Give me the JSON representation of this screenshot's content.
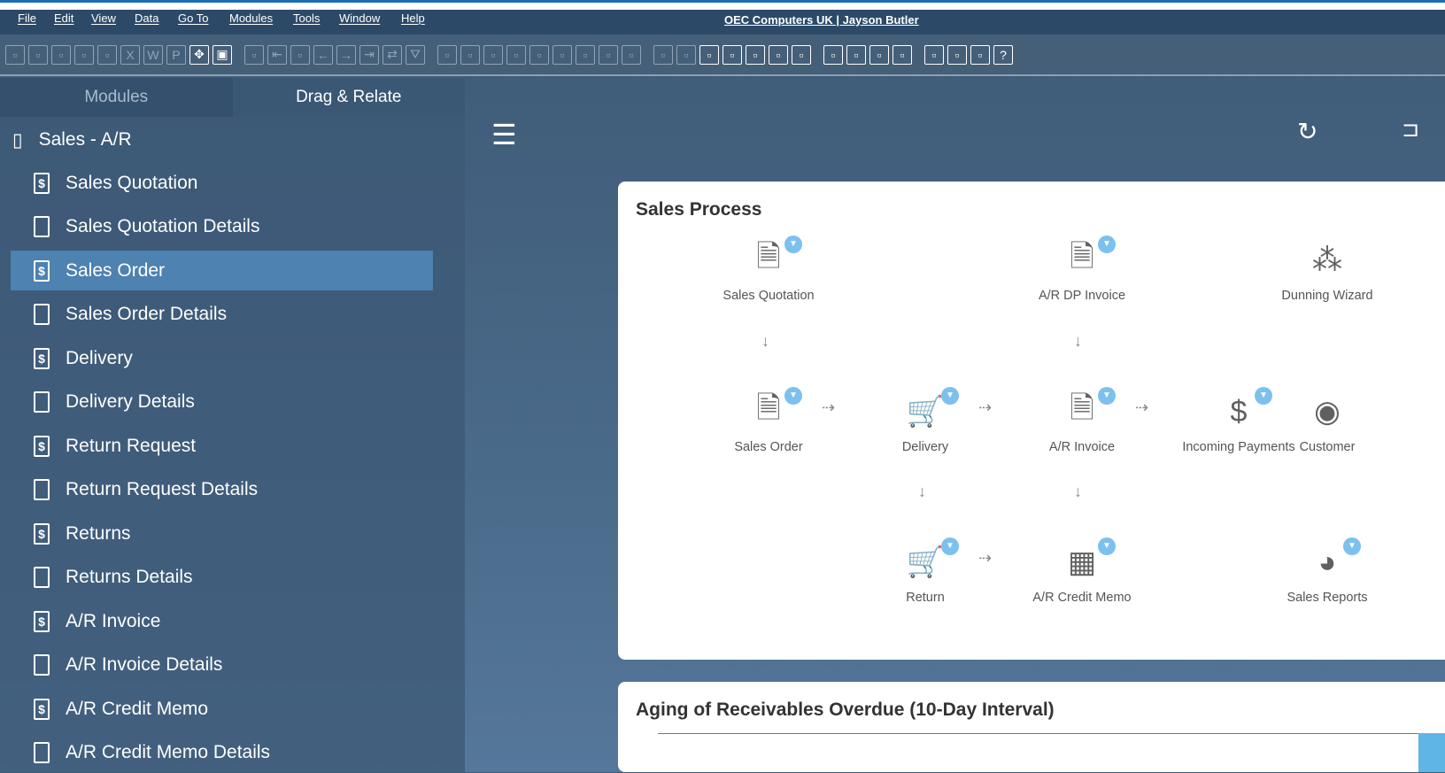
{
  "menu": [
    "File",
    "Edit",
    "View",
    "Data",
    "Go To",
    "Modules",
    "Tools",
    "Window",
    "Help"
  ],
  "company": "OEC Computers UK | Jayson Butler",
  "toolbar_icons": [
    "preview",
    "print",
    "print-preview",
    "email",
    "sms",
    "excel",
    "word",
    "pdf",
    "move",
    "lock-form",
    "binoculars",
    "first",
    "first-record",
    "previous",
    "next",
    "last",
    "refresh-swap",
    "filter",
    "sort",
    "base-doc",
    "target-doc",
    "payment",
    "payment-means",
    "gross-profit",
    "volume",
    "journal",
    "edit",
    "settings",
    "form-settings",
    "message",
    "alerts",
    "approval",
    "alert-info",
    "calculator",
    "org",
    "user",
    "settings-2",
    "layout",
    "query",
    "tasks",
    "browser",
    "help"
  ],
  "sidebar": {
    "tabs": [
      "Modules",
      "Drag & Relate"
    ],
    "module": "Sales - A/R",
    "items": [
      {
        "label": "Sales Quotation",
        "icon": "dollar-doc"
      },
      {
        "label": "Sales Quotation Details",
        "icon": "doc"
      },
      {
        "label": "Sales Order",
        "icon": "dollar-doc",
        "selected": true
      },
      {
        "label": "Sales Order Details",
        "icon": "doc"
      },
      {
        "label": "Delivery",
        "icon": "dollar-doc"
      },
      {
        "label": "Delivery Details",
        "icon": "doc"
      },
      {
        "label": "Return Request",
        "icon": "dollar-doc"
      },
      {
        "label": "Return Request Details",
        "icon": "doc"
      },
      {
        "label": "Returns",
        "icon": "dollar-doc"
      },
      {
        "label": "Returns Details",
        "icon": "doc"
      },
      {
        "label": "A/R Invoice",
        "icon": "dollar-doc"
      },
      {
        "label": "A/R Invoice Details",
        "icon": "doc"
      },
      {
        "label": "A/R Credit Memo",
        "icon": "dollar-doc"
      },
      {
        "label": "A/R Credit Memo Details",
        "icon": "doc"
      }
    ]
  },
  "process": {
    "title": "Sales Process",
    "nodes": [
      {
        "label": "Sales Quotation",
        "icon": "document-icon",
        "glyph": "🗎",
        "drop": true
      },
      {
        "label": "A/R DP Invoice",
        "icon": "dp-invoice-icon",
        "glyph": "🗎",
        "drop": true
      },
      {
        "label": "Dunning Wizard",
        "icon": "dunning-icon",
        "glyph": "⁂",
        "drop": false
      },
      {
        "label": "Sales Order",
        "icon": "document-icon",
        "glyph": "🗎",
        "drop": true
      },
      {
        "label": "Delivery",
        "icon": "cart-icon",
        "glyph": "🛒",
        "drop": true
      },
      {
        "label": "A/R Invoice",
        "icon": "invoice-icon",
        "glyph": "🗎",
        "drop": true
      },
      {
        "label": "Incoming Payments",
        "icon": "payment-icon",
        "glyph": "$",
        "drop": true
      },
      {
        "label": "Customer",
        "icon": "customer-icon",
        "glyph": "◉",
        "drop": false
      },
      {
        "label": "Return",
        "icon": "cart-return-icon",
        "glyph": "🛒",
        "drop": true
      },
      {
        "label": "A/R Credit Memo",
        "icon": "credit-memo-icon",
        "glyph": "▦",
        "drop": true
      },
      {
        "label": "Sales Reports",
        "icon": "pie-chart-icon",
        "glyph": "◕",
        "drop": true
      }
    ]
  },
  "aging": {
    "title": "Aging of Receivables Overdue (10-Day Interval)"
  },
  "colors": {
    "accent": "#4d82b1",
    "drop": "#7cc0ef"
  }
}
